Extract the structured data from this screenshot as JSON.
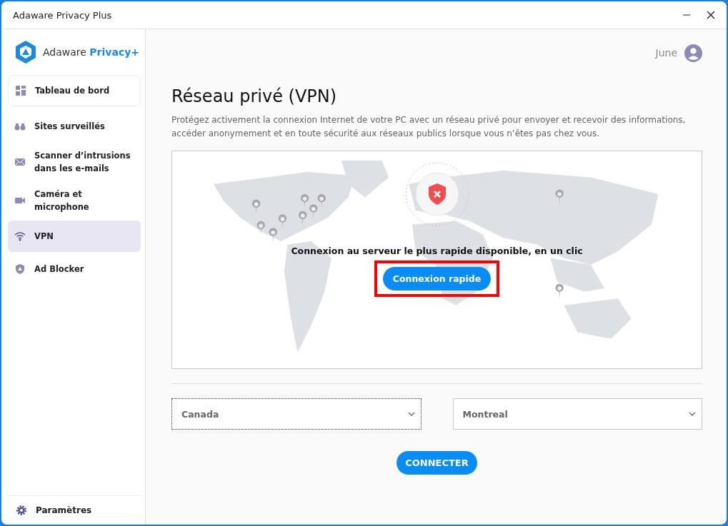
{
  "window": {
    "title": "Adaware Privacy Plus"
  },
  "logo": {
    "name": "Adaware",
    "accent": "Privacy+"
  },
  "sidebar": {
    "items": [
      {
        "label": "Tableau de bord",
        "selected": false
      },
      {
        "label": "Sites surveillés",
        "selected": false
      },
      {
        "label": "Scanner d’intrusions dans les e-mails",
        "selected": false
      },
      {
        "label": "Caméra et microphone",
        "selected": false
      },
      {
        "label": "VPN",
        "selected": true
      },
      {
        "label": "Ad Blocker",
        "selected": false
      }
    ],
    "settings": "Paramètres"
  },
  "user": {
    "name": "June"
  },
  "page": {
    "title": "Réseau privé (VPN)",
    "description": "Protégez activement la connexion Internet de votre PC avec un réseau privé pour envoyer et recevoir des informations, accéder anonymement et en toute sécurité aux réseaux publics lorsque vous n’êtes pas chez vous."
  },
  "map": {
    "connected": false,
    "message": "Connexion au serveur le plus rapide disponible, en un clic",
    "quick_button": {
      "label": "Connexion rapide",
      "highlighted": true
    }
  },
  "country_select": {
    "value": "Canada",
    "focused": true
  },
  "city_select": {
    "value": "Montreal",
    "focused": false
  },
  "connect_button": "CONNECTER"
}
